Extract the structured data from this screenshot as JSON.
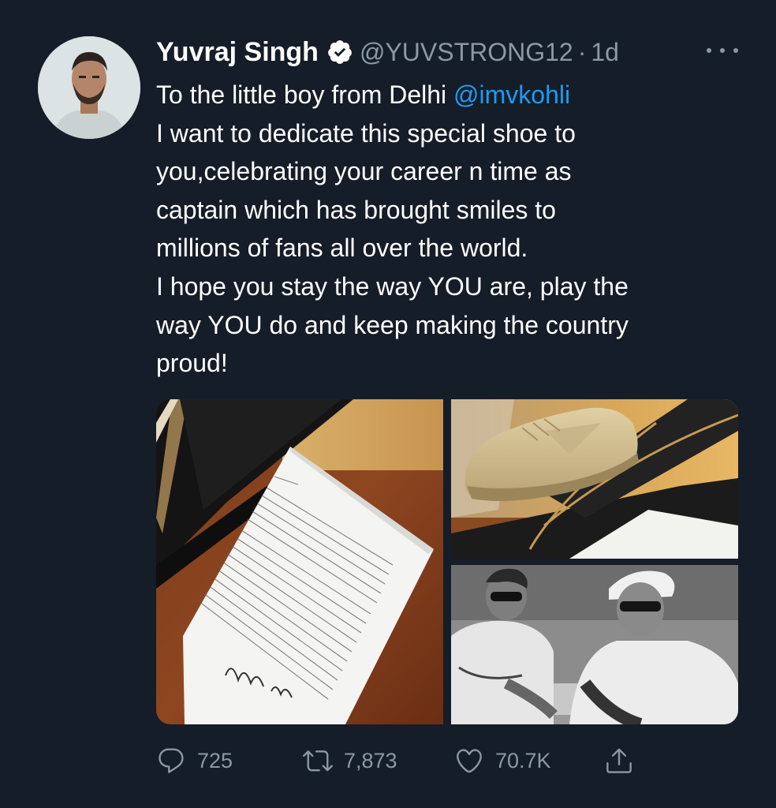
{
  "tweet": {
    "author": {
      "name": "Yuvraj Singh",
      "handle": "@YUVSTRONG12",
      "separator": "·",
      "time": "1d",
      "verified": true
    },
    "text_lines": [
      {
        "before": "To the little boy from Delhi ",
        "mention": "@imvkohli"
      },
      "I want to dedicate this special shoe to",
      "you,celebrating your career n time as",
      "captain which has brought smiles to",
      "millions of fans all over the world.",
      "I hope you stay the way YOU are, play the",
      "way YOU do and keep making the country",
      "proud!"
    ],
    "media": [
      {
        "name": "handwritten-letter-photo",
        "description_icon": "photo"
      },
      {
        "name": "gold-shoe-photo",
        "description_icon": "photo"
      },
      {
        "name": "two-men-black-white-photo",
        "description_icon": "photo"
      }
    ],
    "actions": {
      "reply_count": "725",
      "retweet_count": "7,873",
      "like_count": "70.7K"
    }
  },
  "colors": {
    "background": "#151d28",
    "text": "#ffffff",
    "secondary": "#8b98a5",
    "link": "#1d9bf0"
  },
  "icons": [
    "verified-badge-icon",
    "more-options-icon",
    "reply-icon",
    "retweet-icon",
    "like-icon",
    "share-icon"
  ]
}
